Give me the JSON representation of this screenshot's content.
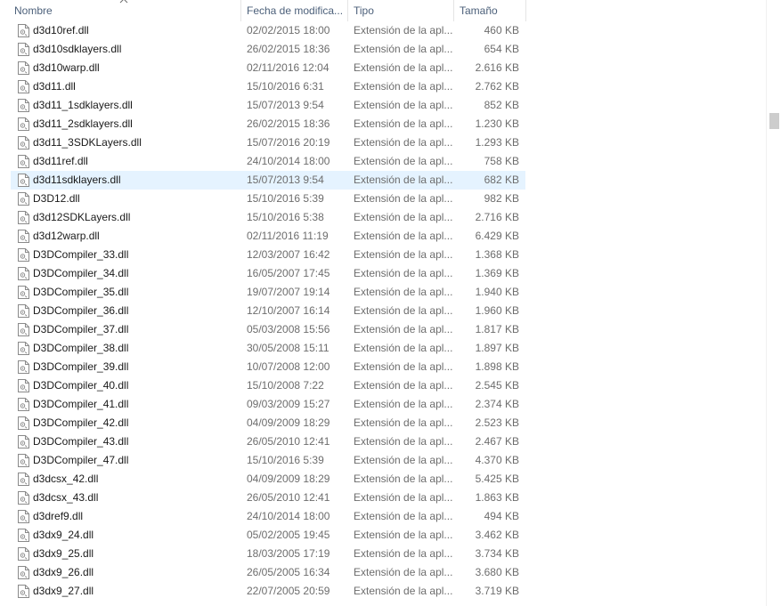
{
  "columns": {
    "name": "Nombre",
    "date": "Fecha de modifica...",
    "type": "Tipo",
    "size": "Tamaño"
  },
  "files": [
    {
      "name": "d3d10ref.dll",
      "date": "02/02/2015 18:00",
      "type": "Extensión de la apl...",
      "size": "460 KB"
    },
    {
      "name": "d3d10sdklayers.dll",
      "date": "26/02/2015 18:36",
      "type": "Extensión de la apl...",
      "size": "654 KB"
    },
    {
      "name": "d3d10warp.dll",
      "date": "02/11/2016 12:04",
      "type": "Extensión de la apl...",
      "size": "2.616 KB"
    },
    {
      "name": "d3d11.dll",
      "date": "15/10/2016 6:31",
      "type": "Extensión de la apl...",
      "size": "2.762 KB"
    },
    {
      "name": "d3d11_1sdklayers.dll",
      "date": "15/07/2013 9:54",
      "type": "Extensión de la apl...",
      "size": "852 KB"
    },
    {
      "name": "d3d11_2sdklayers.dll",
      "date": "26/02/2015 18:36",
      "type": "Extensión de la apl...",
      "size": "1.230 KB"
    },
    {
      "name": "d3d11_3SDKLayers.dll",
      "date": "15/07/2016 20:19",
      "type": "Extensión de la apl...",
      "size": "1.293 KB"
    },
    {
      "name": "d3d11ref.dll",
      "date": "24/10/2014 18:00",
      "type": "Extensión de la apl...",
      "size": "758 KB"
    },
    {
      "name": "d3d11sdklayers.dll",
      "date": "15/07/2013 9:54",
      "type": "Extensión de la apl...",
      "size": "682 KB",
      "selected": true
    },
    {
      "name": "D3D12.dll",
      "date": "15/10/2016 5:39",
      "type": "Extensión de la apl...",
      "size": "982 KB"
    },
    {
      "name": "d3d12SDKLayers.dll",
      "date": "15/10/2016 5:38",
      "type": "Extensión de la apl...",
      "size": "2.716 KB"
    },
    {
      "name": "d3d12warp.dll",
      "date": "02/11/2016 11:19",
      "type": "Extensión de la apl...",
      "size": "6.429 KB"
    },
    {
      "name": "D3DCompiler_33.dll",
      "date": "12/03/2007 16:42",
      "type": "Extensión de la apl...",
      "size": "1.368 KB"
    },
    {
      "name": "D3DCompiler_34.dll",
      "date": "16/05/2007 17:45",
      "type": "Extensión de la apl...",
      "size": "1.369 KB"
    },
    {
      "name": "D3DCompiler_35.dll",
      "date": "19/07/2007 19:14",
      "type": "Extensión de la apl...",
      "size": "1.940 KB"
    },
    {
      "name": "D3DCompiler_36.dll",
      "date": "12/10/2007 16:14",
      "type": "Extensión de la apl...",
      "size": "1.960 KB"
    },
    {
      "name": "D3DCompiler_37.dll",
      "date": "05/03/2008 15:56",
      "type": "Extensión de la apl...",
      "size": "1.817 KB"
    },
    {
      "name": "D3DCompiler_38.dll",
      "date": "30/05/2008 15:11",
      "type": "Extensión de la apl...",
      "size": "1.897 KB"
    },
    {
      "name": "D3DCompiler_39.dll",
      "date": "10/07/2008 12:00",
      "type": "Extensión de la apl...",
      "size": "1.898 KB"
    },
    {
      "name": "D3DCompiler_40.dll",
      "date": "15/10/2008 7:22",
      "type": "Extensión de la apl...",
      "size": "2.545 KB"
    },
    {
      "name": "D3DCompiler_41.dll",
      "date": "09/03/2009 15:27",
      "type": "Extensión de la apl...",
      "size": "2.374 KB"
    },
    {
      "name": "D3DCompiler_42.dll",
      "date": "04/09/2009 18:29",
      "type": "Extensión de la apl...",
      "size": "2.523 KB"
    },
    {
      "name": "D3DCompiler_43.dll",
      "date": "26/05/2010 12:41",
      "type": "Extensión de la apl...",
      "size": "2.467 KB"
    },
    {
      "name": "D3DCompiler_47.dll",
      "date": "15/10/2016 5:39",
      "type": "Extensión de la apl...",
      "size": "4.370 KB"
    },
    {
      "name": "d3dcsx_42.dll",
      "date": "04/09/2009 18:29",
      "type": "Extensión de la apl...",
      "size": "5.425 KB"
    },
    {
      "name": "d3dcsx_43.dll",
      "date": "26/05/2010 12:41",
      "type": "Extensión de la apl...",
      "size": "1.863 KB"
    },
    {
      "name": "d3dref9.dll",
      "date": "24/10/2014 18:00",
      "type": "Extensión de la apl...",
      "size": "494 KB"
    },
    {
      "name": "d3dx9_24.dll",
      "date": "05/02/2005 19:45",
      "type": "Extensión de la apl...",
      "size": "3.462 KB"
    },
    {
      "name": "d3dx9_25.dll",
      "date": "18/03/2005 17:19",
      "type": "Extensión de la apl...",
      "size": "3.734 KB"
    },
    {
      "name": "d3dx9_26.dll",
      "date": "26/05/2005 16:34",
      "type": "Extensión de la apl...",
      "size": "3.680 KB"
    },
    {
      "name": "d3dx9_27.dll",
      "date": "22/07/2005 20:59",
      "type": "Extensión de la apl...",
      "size": "3.719 KB"
    }
  ],
  "icons": {
    "file": "dll-file-icon",
    "sort": "sort-chevron-up-icon"
  },
  "colors": {
    "selection": "#e5f3ff",
    "header_text": "#4c607a"
  }
}
